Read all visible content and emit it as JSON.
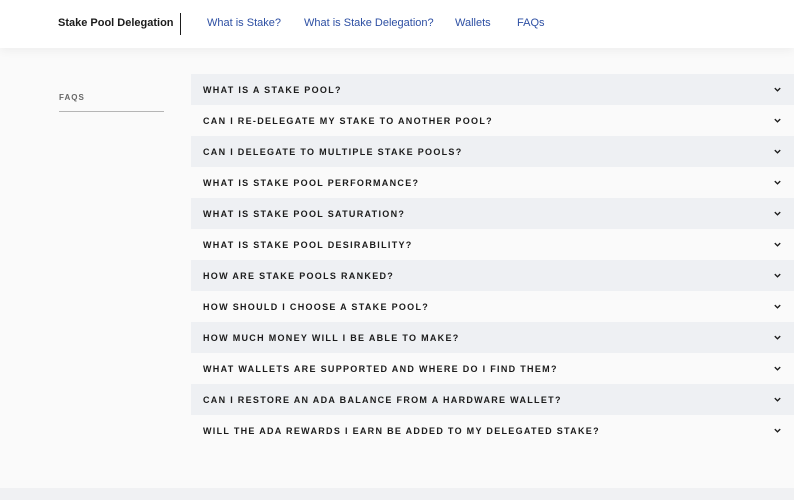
{
  "header": {
    "brand": "Stake Pool Delegation",
    "nav": [
      {
        "label": "What is Stake?"
      },
      {
        "label": "What is Stake Delegation?"
      },
      {
        "label": "Wallets"
      },
      {
        "label": "FAQs"
      }
    ]
  },
  "sidebar": {
    "label": "FAQS"
  },
  "faqs": [
    {
      "question": "WHAT IS A STAKE POOL?"
    },
    {
      "question": "CAN I RE-DELEGATE MY STAKE TO ANOTHER POOL?"
    },
    {
      "question": "CAN I DELEGATE TO MULTIPLE STAKE POOLS?"
    },
    {
      "question": "WHAT IS STAKE POOL PERFORMANCE?"
    },
    {
      "question": "WHAT IS STAKE POOL SATURATION?"
    },
    {
      "question": "WHAT IS STAKE POOL DESIRABILITY?"
    },
    {
      "question": "HOW ARE STAKE POOLS RANKED?"
    },
    {
      "question": "HOW SHOULD I CHOOSE A STAKE POOL?"
    },
    {
      "question": "HOW MUCH MONEY WILL I BE ABLE TO MAKE?"
    },
    {
      "question": "WHAT WALLETS ARE SUPPORTED AND WHERE DO I FIND THEM?"
    },
    {
      "question": "CAN I RESTORE AN ADA BALANCE FROM A HARDWARE WALLET?"
    },
    {
      "question": "WILL THE ADA REWARDS I EARN BE ADDED TO MY DELEGATED STAKE?"
    }
  ],
  "icons": {
    "expand": "chevron-down-icon"
  },
  "colors": {
    "nav_link": "#2d4fa3",
    "row_shade": "#eef0f3",
    "text": "#1b1b1b"
  }
}
